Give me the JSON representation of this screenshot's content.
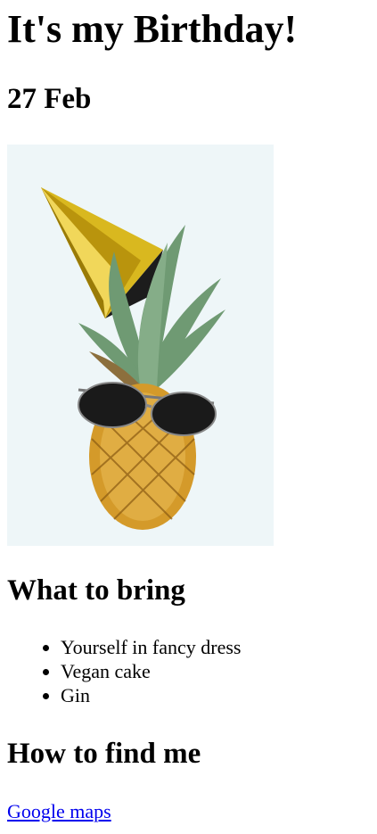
{
  "page": {
    "title": "It's my Birthday!",
    "date": "27 Feb"
  },
  "photo": {
    "icon": "pineapple-with-party-hat-and-sunglasses"
  },
  "bring": {
    "heading": "What to bring",
    "items": [
      "Yourself in fancy dress",
      "Vegan cake",
      "Gin"
    ]
  },
  "find": {
    "heading": "How to find me",
    "link_label": "Google maps"
  },
  "colors": {
    "link": "#0000ee",
    "photo_background": "#eef6f8",
    "hat_gold": "#d9b81f",
    "pineapple": "#d49a2a",
    "leaves": "#6f9a73"
  }
}
